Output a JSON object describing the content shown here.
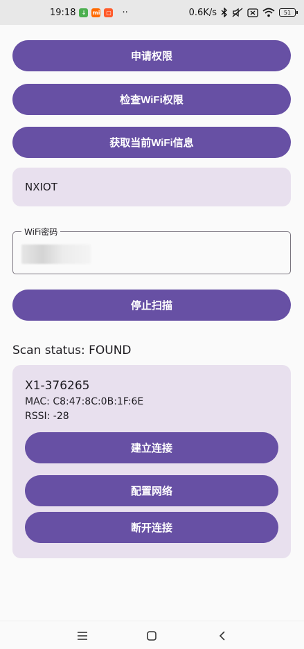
{
  "status_bar": {
    "time": "19:18",
    "notifications": [
      "download-icon",
      "mi-icon",
      "shop-icon"
    ],
    "more": "··",
    "net_speed": "0.6K/s",
    "battery": "51"
  },
  "buttons": {
    "request_permission": "申请权限",
    "check_wifi_permission": "检查WiFi权限",
    "get_wifi_info": "获取当前WiFi信息",
    "stop_scan": "停止扫描"
  },
  "wifi": {
    "ssid": "NXIOT",
    "password_label": "WiFi密码"
  },
  "scan": {
    "status": "Scan status: FOUND"
  },
  "device": {
    "name": "X1-376265",
    "mac": "MAC: C8:47:8C:0B:1F:6E",
    "rssi": "RSSI: -28",
    "connect_label": "建立连接",
    "configure_label": "配置网络",
    "disconnect_label": "断开连接"
  },
  "colors": {
    "primary": "#6750a4",
    "surface_variant": "#e8e0ee",
    "background": "#fafafa"
  },
  "nav": {
    "icons": [
      "menu-icon",
      "home-icon",
      "back-icon"
    ]
  }
}
